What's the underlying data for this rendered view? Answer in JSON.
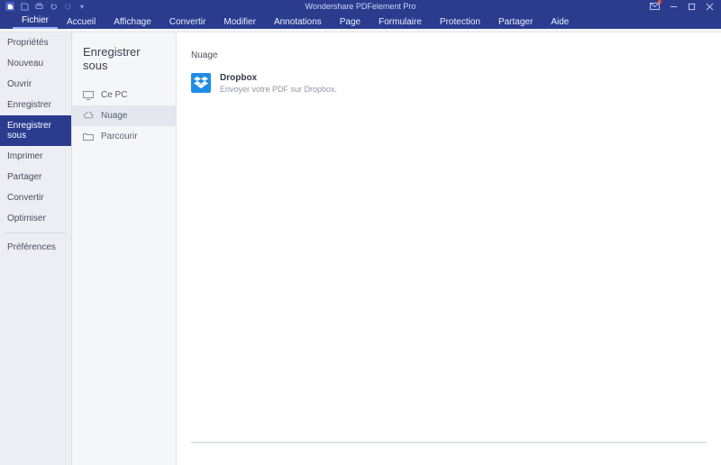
{
  "app": {
    "title": "Wondershare PDFelement Pro"
  },
  "tabs": {
    "fichier": "Fichier",
    "accueil": "Accueil",
    "affichage": "Affichage",
    "convertir": "Convertir",
    "modifier": "Modifier",
    "annotations": "Annotations",
    "page": "Page",
    "formulaire": "Formulaire",
    "protection": "Protection",
    "partager": "Partager",
    "aide": "Aide"
  },
  "file_menu": {
    "proprietes": "Propriétés",
    "nouveau": "Nouveau",
    "ouvrir": "Ouvrir",
    "enregistrer": "Enregistrer",
    "enregistrer_sous": "Enregistrer sous",
    "imprimer": "Imprimer",
    "partager": "Partager",
    "convertir": "Convertir",
    "optimiser": "Optimiser",
    "preferences": "Préférences"
  },
  "saveas": {
    "heading": "Enregistrer sous",
    "locations": {
      "ce_pc": "Ce PC",
      "nuage": "Nuage",
      "parcourir": "Parcourir"
    }
  },
  "cloud": {
    "section_title": "Nuage",
    "providers": [
      {
        "name": "Dropbox",
        "desc": "Envoyer votre PDF sur Dropbox."
      }
    ]
  }
}
